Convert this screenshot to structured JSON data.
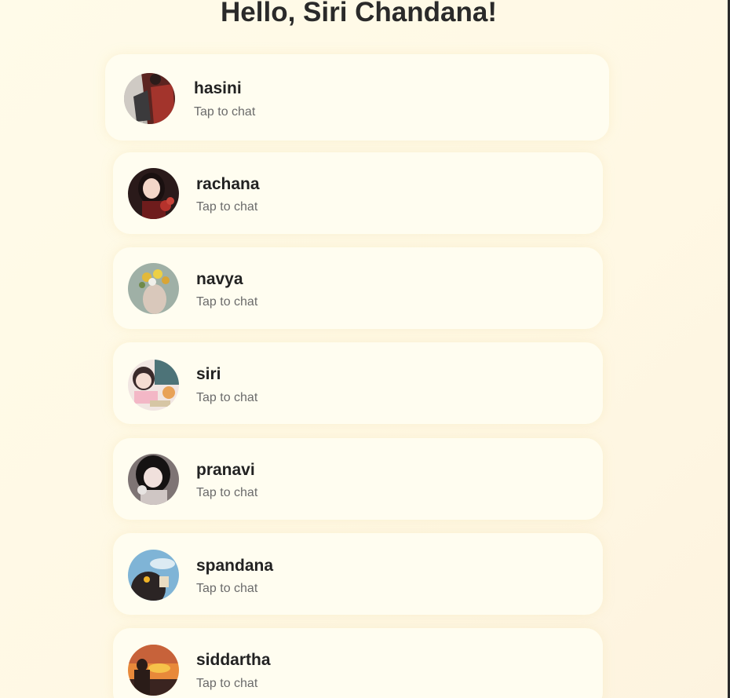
{
  "header": {
    "greeting": "Hello, Siri Chandana!"
  },
  "chats": [
    {
      "name": "hasini",
      "subtitle": "Tap to chat",
      "avatar_icon": "profile-photo-icon"
    },
    {
      "name": "rachana",
      "subtitle": "Tap to chat",
      "avatar_icon": "profile-photo-icon"
    },
    {
      "name": "navya",
      "subtitle": "Tap to chat",
      "avatar_icon": "profile-photo-icon"
    },
    {
      "name": "siri",
      "subtitle": "Tap to chat",
      "avatar_icon": "profile-photo-icon"
    },
    {
      "name": "pranavi",
      "subtitle": "Tap to chat",
      "avatar_icon": "profile-photo-icon"
    },
    {
      "name": "spandana",
      "subtitle": "Tap to chat",
      "avatar_icon": "profile-photo-icon"
    },
    {
      "name": "siddartha",
      "subtitle": "Tap to chat",
      "avatar_icon": "profile-photo-icon"
    }
  ],
  "colors": {
    "background": "#fffbe9",
    "card": "#fffdf0",
    "title_text": "#2a2a2a",
    "subtitle_text": "#6b6b6b"
  }
}
